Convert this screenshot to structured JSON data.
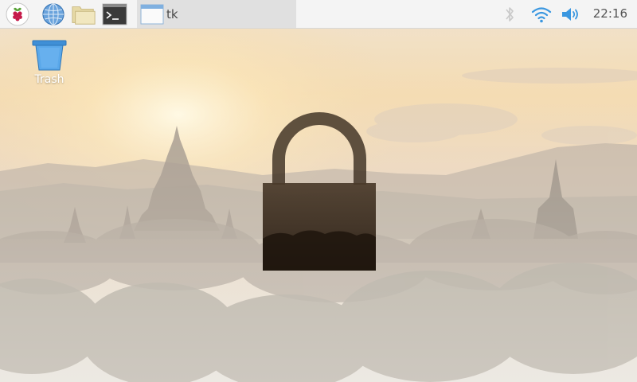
{
  "taskbar": {
    "launchers": [
      {
        "name": "raspberry-menu",
        "icon": "raspberry-icon"
      },
      {
        "name": "web-browser",
        "icon": "globe-icon"
      },
      {
        "name": "file-manager",
        "icon": "folder-icon"
      },
      {
        "name": "terminal",
        "icon": "terminal-icon"
      }
    ],
    "tasks": [
      {
        "label": "tk",
        "icon": "window-icon"
      }
    ],
    "tray": {
      "bluetooth_icon": "bluetooth-icon",
      "wifi_icon": "wifi-icon",
      "volume_icon": "volume-icon",
      "clock": "22:16"
    }
  },
  "desktop": {
    "icons": [
      {
        "label": "Trash",
        "icon": "trash-icon"
      }
    ],
    "overlay": {
      "icon": "padlock-icon"
    }
  },
  "colors": {
    "taskbar_bg": "#f4f4f4",
    "active_task_bg": "#e0e0e0",
    "accent_blue": "#3a97e0",
    "padlock": "#2e2216"
  }
}
